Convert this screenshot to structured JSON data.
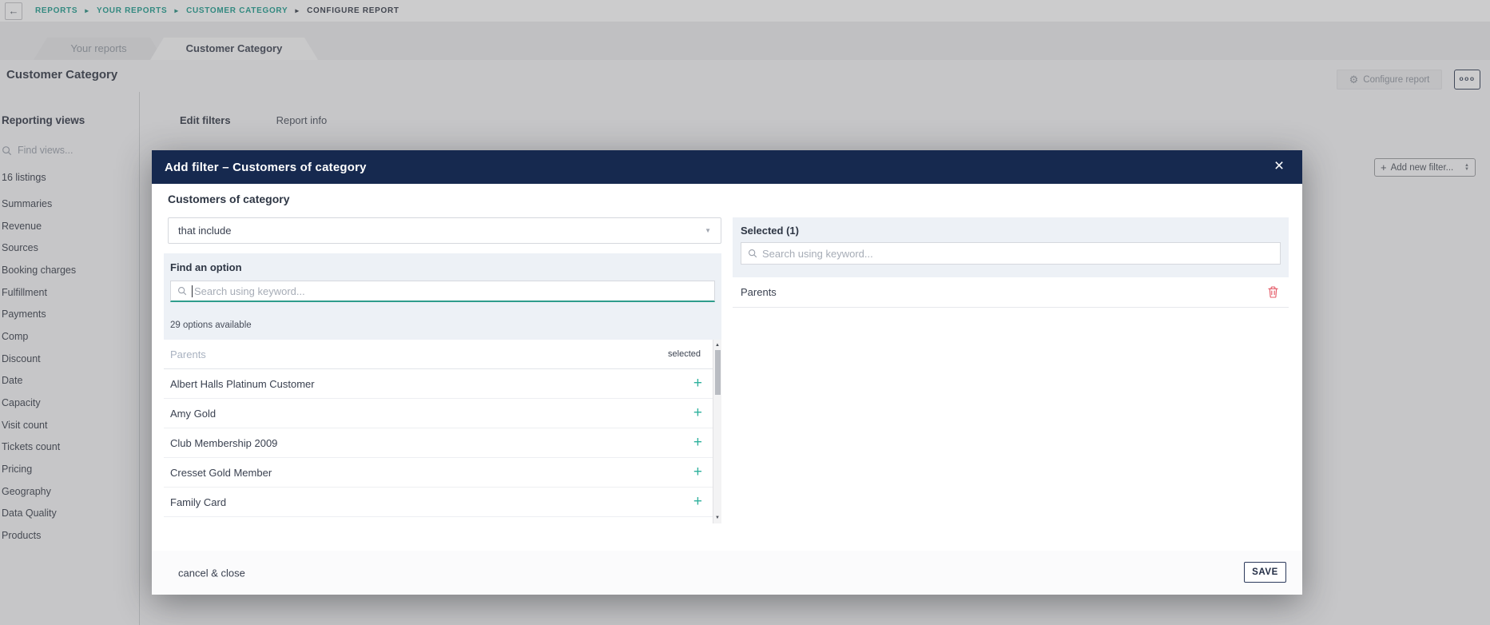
{
  "breadcrumb": {
    "items": [
      "REPORTS",
      "YOUR REPORTS",
      "CUSTOMER CATEGORY",
      "CONFIGURE REPORT"
    ]
  },
  "window_tabs": {
    "your_reports": "Your reports",
    "customer_category": "Customer Category"
  },
  "header": {
    "title": "Customer Category",
    "configure_button": "Configure report",
    "more_button": "ooo"
  },
  "sidebar": {
    "title": "Reporting views",
    "search_placeholder": "Find views...",
    "count": "16 listings",
    "items": [
      "Summaries",
      "Revenue",
      "Sources",
      "Booking charges",
      "Fulfillment",
      "Payments",
      "Comp",
      "Discount",
      "Date",
      "Capacity",
      "Visit count",
      "Tickets count",
      "Pricing",
      "Geography",
      "Data Quality",
      "Products"
    ]
  },
  "content_tabs": {
    "edit_filters": "Edit filters",
    "report_info": "Report info"
  },
  "add_filter_button": {
    "label": "Add new filter..."
  },
  "modal": {
    "title": "Add filter – Customers of category",
    "field_label": "Customers of category",
    "condition": {
      "value": "that include"
    },
    "options_panel": {
      "label": "Find an option",
      "search_placeholder": "Search using keyword...",
      "count": "29 options available",
      "column_header": "Parents",
      "selected_column": "selected",
      "options": [
        "Albert Halls Platinum Customer",
        "Amy Gold",
        "Club Membership 2009",
        "Cresset Gold Member",
        "Family Card"
      ]
    },
    "selected_panel": {
      "title": "Selected (1)",
      "search_placeholder": "Search using keyword...",
      "items": [
        "Parents"
      ]
    },
    "footer": {
      "cancel": "cancel & close",
      "save": "SAVE"
    }
  },
  "icons": {
    "back": "←",
    "crumb_sep": "▶",
    "gear": "⚙",
    "close": "×",
    "plus": "+",
    "caret_down": "▼",
    "sort_up": "▲",
    "sort_down": "▼",
    "scroll_up": "▲",
    "scroll_down": "▼"
  },
  "colors": {
    "accent_teal": "#189a8a",
    "navy": "#16294f",
    "plus_green": "#2fb19d",
    "delete_red": "#e45865",
    "focus_underline": "#2f9d8c"
  }
}
